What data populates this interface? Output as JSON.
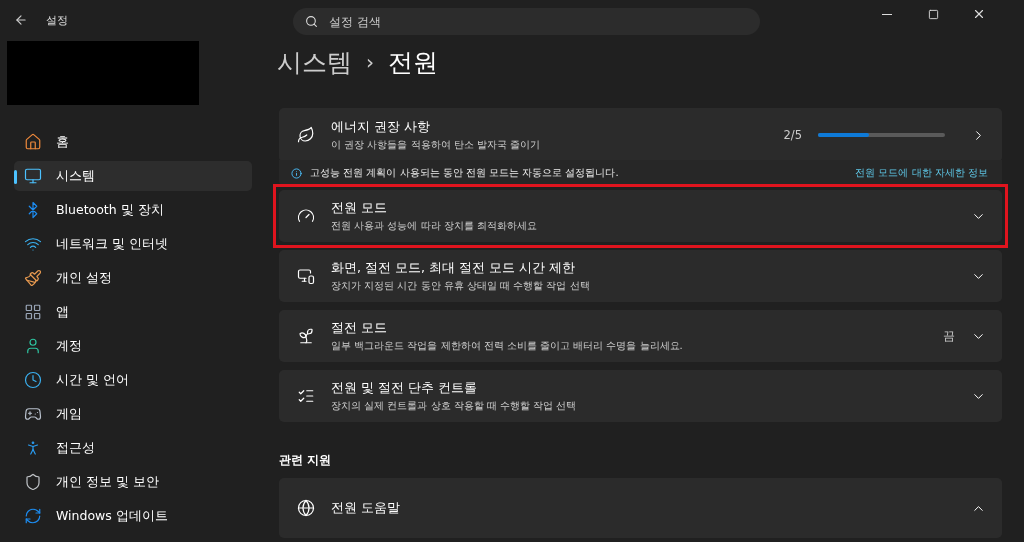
{
  "window": {
    "title": "설정"
  },
  "search": {
    "placeholder": "설정 검색"
  },
  "sidebar": {
    "items": [
      {
        "label": "홈",
        "selected": false
      },
      {
        "label": "시스템",
        "selected": true
      },
      {
        "label": "Bluetooth 및 장치",
        "selected": false
      },
      {
        "label": "네트워크 및 인터넷",
        "selected": false
      },
      {
        "label": "개인 설정",
        "selected": false
      },
      {
        "label": "앱",
        "selected": false
      },
      {
        "label": "계정",
        "selected": false
      },
      {
        "label": "시간 및 언어",
        "selected": false
      },
      {
        "label": "게임",
        "selected": false
      },
      {
        "label": "접근성",
        "selected": false
      },
      {
        "label": "개인 정보 및 보안",
        "selected": false
      },
      {
        "label": "Windows 업데이트",
        "selected": false
      }
    ]
  },
  "breadcrumb": {
    "parent": "시스템",
    "separator": "›",
    "current": "전원"
  },
  "cards": [
    {
      "kind": "link",
      "title": "에너지 권장 사항",
      "subtitle": "이 권장 사항들을 적용하여 탄소 발자국 줄이기",
      "value": "2/5",
      "level": 0.4,
      "highlighted": false
    },
    {
      "kind": "info",
      "text": "고성능 전원 계획이 사용되는 동안 전원 모드는 자동으로 설정됩니다.",
      "link": "전원 모드에 대한 자세한 정보"
    },
    {
      "kind": "expander",
      "title": "전원 모드",
      "subtitle": "전원 사용과 성능에 따라 장치를 최적화하세요",
      "expanded": false,
      "highlighted": true
    },
    {
      "kind": "expander",
      "title": "화면, 절전 모드, 최대 절전 모드 시간 제한",
      "subtitle": "장치가 지정된 시간 동안 유휴 상태일 때 수행할 작업 선택",
      "expanded": false,
      "highlighted": false
    },
    {
      "kind": "expander",
      "title": "절전 모드",
      "subtitle": "일부 백그라운드 작업을 제한하여 전력 소비를 줄이고 배터리 수명을 늘리세요.",
      "value": "끔",
      "expanded": false,
      "highlighted": false
    },
    {
      "kind": "expander",
      "title": "전원 및 절전 단추 컨트롤",
      "subtitle": "장치의 실제 컨트롤과 상호 작용할 때 수행할 작업 선택",
      "expanded": false,
      "highlighted": false
    }
  ],
  "related": {
    "heading": "관련 지원",
    "items": [
      {
        "title": "전원 도움말",
        "expanded": true
      }
    ]
  }
}
